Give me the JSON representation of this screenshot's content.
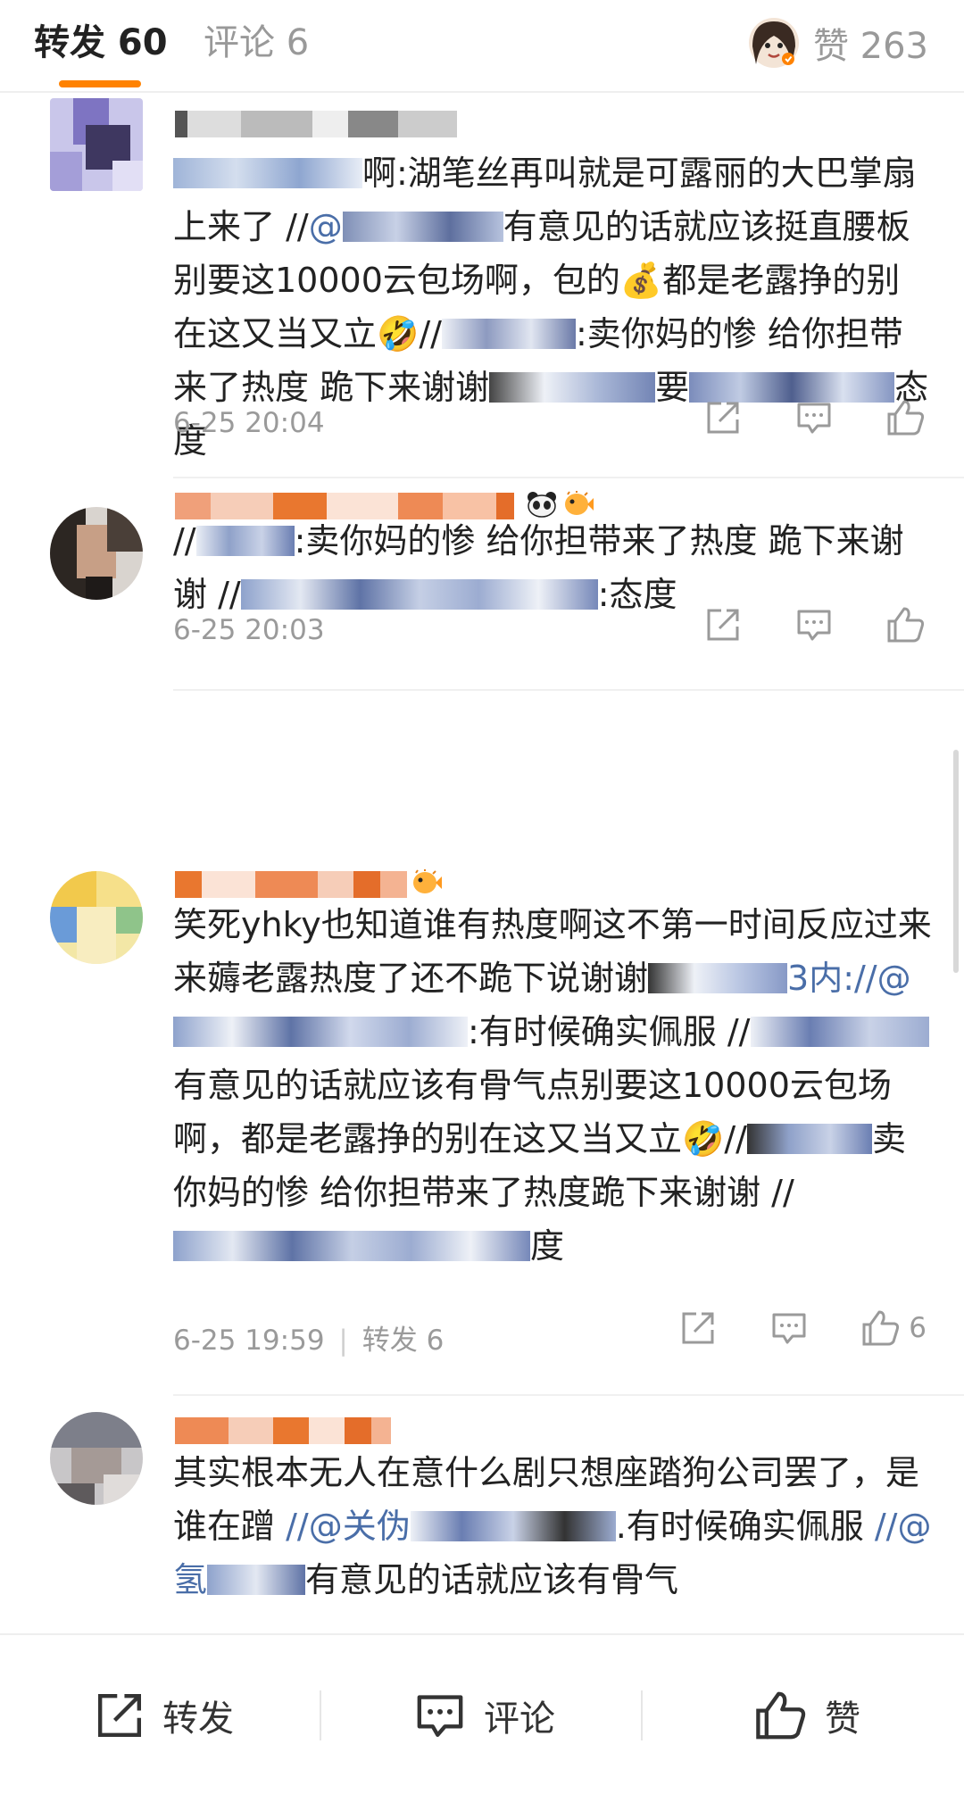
{
  "tabs": {
    "repost_label": "转发 60",
    "comment_label": "评论 6",
    "likes_label": "赞 263"
  },
  "comments": [
    {
      "body": {
        "t1": "啊:湖笔丝再叫就是可露丽的大巴掌扇上来了 //",
        "at1": "@",
        "t2": "有意见的话就应该挺直腰板别要这10000云包场啊，包的",
        "e1": "💰",
        "t3": "都是老露挣的别在这又当又立",
        "e2": "🤣",
        "t4": "//",
        "t5": ":卖你妈的惨 给你担带来了热度 跪下来谢谢",
        "t6": "要",
        "t7": "态度"
      },
      "time": "6-25 20:04"
    },
    {
      "body": {
        "t1": "//",
        "t2": ":卖你妈的惨 给你担带来了热度 跪下来谢谢 //",
        "t3": ":态度"
      },
      "time": "6-25 20:03"
    },
    {
      "body": {
        "t1": "笑死yhky也知道谁有热度啊这不第一时间反应过来来薅老露热度了还不跪下说谢谢",
        "t2": "3内:",
        "at1": "//@",
        "t3": ":有时候确实佩服 //",
        "t4": "有意见的话就应该有骨气点别要这10000云包场啊，都是老露挣的别在这又当又立",
        "e1": "🤣",
        "t5": "//",
        "t6": "卖你妈的惨 给你担带来了热度跪下来谢谢 //",
        "t7": "度"
      },
      "time": "6-25 19:59",
      "sep": "|",
      "repost": "转发 6",
      "like_count": "6"
    },
    {
      "body": {
        "t1": "其实根本无人在意什么剧只想座踏狗公司罢了，是谁在蹭 ",
        "at1": "//@关伪",
        "t2": ".有时候确实佩服 ",
        "at2": "//@氢",
        "t3": "有意见的话就应该有骨气"
      }
    }
  ],
  "bottom": {
    "repost": "转发",
    "comment": "评论",
    "like": "赞"
  },
  "colors": {
    "accent": "#ff8200",
    "mention": "#4a6ea8",
    "meta": "#9a9a9a"
  }
}
